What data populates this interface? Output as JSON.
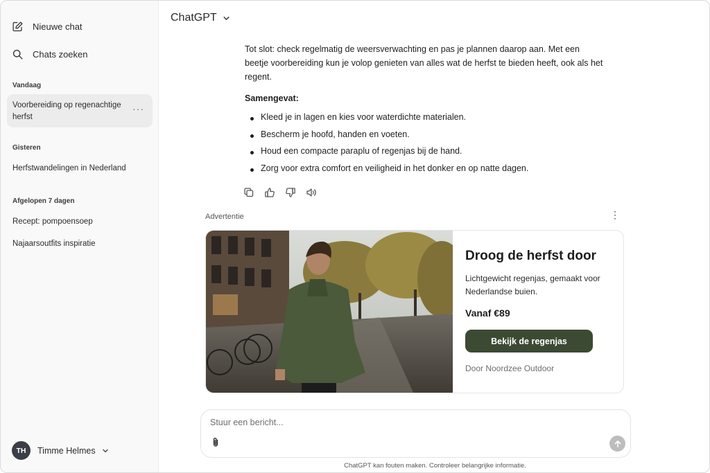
{
  "sidebar": {
    "new_chat": "Nieuwe chat",
    "search_chats": "Chats zoeken",
    "sections": [
      {
        "label": "Vandaag",
        "items": [
          "Voorbereiding op regenachtige herfst"
        ]
      },
      {
        "label": "Gisteren",
        "items": [
          "Herfstwandelingen in Nederland"
        ]
      },
      {
        "label": "Afgelopen 7 dagen",
        "items": [
          "Recept: pompoensoep",
          "Najaarsoutfits inspiratie"
        ]
      }
    ],
    "active_item_more": "···",
    "user": {
      "initials": "TH",
      "name": "Timme Helmes"
    }
  },
  "header": {
    "model": "ChatGPT"
  },
  "message": {
    "closing": "Tot slot: check regelmatig de weersverwachting en pas je plannen daarop aan. Met een beetje voorbereiding kun je volop genieten van alles wat de herfst te bieden heeft, ook als het regent.",
    "summary_heading": "Samengevat:",
    "bullets": [
      "Kleed je in lagen en kies voor waterdichte materialen.",
      "Bescherm je hoofd, handen en voeten.",
      "Houd een compacte paraplu of regenjas bij de hand.",
      "Zorg voor extra comfort en veiligheid in het donker en op natte dagen."
    ],
    "actions": [
      "copy-icon",
      "thumbs-up-icon",
      "thumbs-down-icon",
      "speaker-icon"
    ]
  },
  "ad": {
    "label": "Advertentie",
    "menu": "⋮",
    "title": "Droog de herfst door",
    "description": "Lichtgewicht regenjas, gemaakt voor Nederlandse buien.",
    "price": "Vanaf €89",
    "cta": "Bekijk de regenjas",
    "sponsor": "Door Noordzee Outdoor",
    "button_color": "#3c4a34"
  },
  "composer": {
    "placeholder": "Stuur een bericht..."
  },
  "footer": "ChatGPT kan fouten maken. Controleer belangrijke informatie."
}
